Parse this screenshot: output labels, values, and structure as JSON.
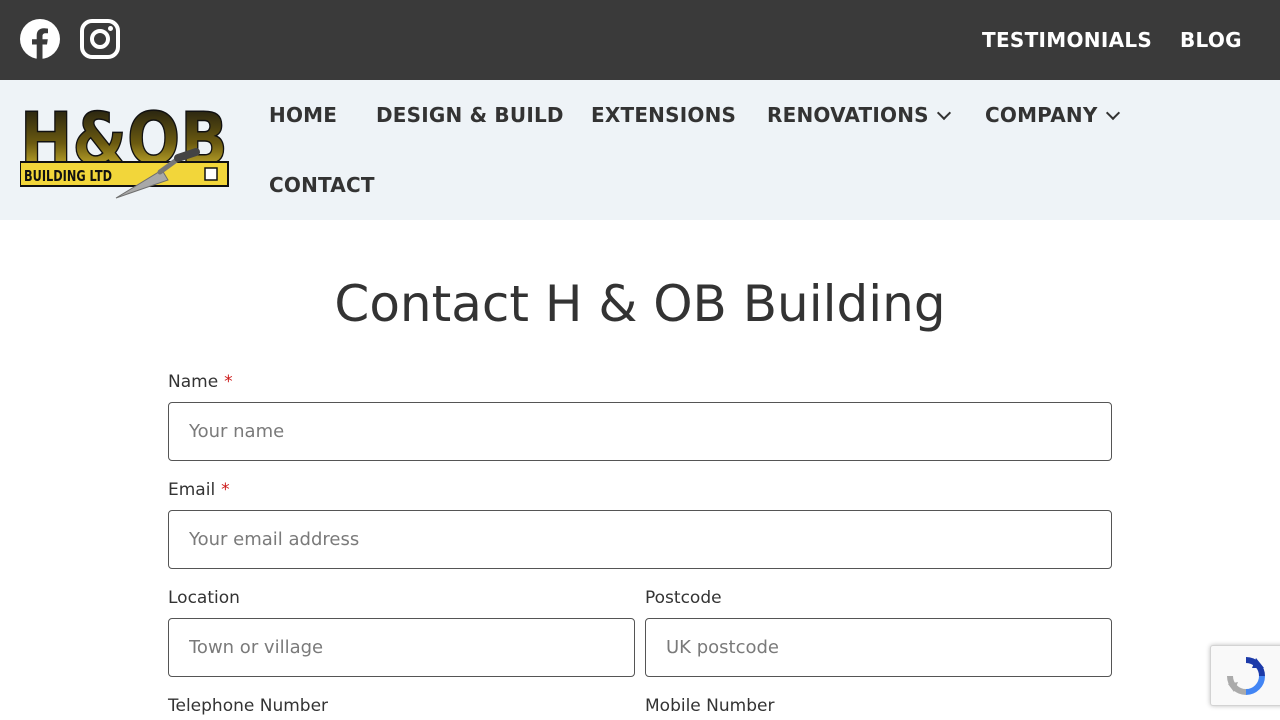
{
  "topbar": {
    "social": [
      {
        "name": "facebook-icon"
      },
      {
        "name": "instagram-icon"
      }
    ],
    "links": [
      "TESTIMONIALS",
      "BLOG"
    ]
  },
  "logo": {
    "text_main": "H&OB",
    "text_sub": "BUILDING LTD",
    "colors": {
      "yellow": "#f2d63a",
      "black": "#111111"
    }
  },
  "nav": {
    "items": [
      "HOME",
      "DESIGN & BUILD",
      "EXTENSIONS",
      "RENOVATIONS",
      "COMPANY",
      "CONTACT"
    ]
  },
  "page": {
    "title": "Contact H & OB Building"
  },
  "form": {
    "name": {
      "label": "Name",
      "required": "*",
      "placeholder": "Your name"
    },
    "email": {
      "label": "Email",
      "required": "*",
      "placeholder": "Your email address"
    },
    "location": {
      "label": "Location",
      "placeholder": "Town or village"
    },
    "postcode": {
      "label": "Postcode",
      "placeholder": "UK postcode"
    },
    "telephone": {
      "label": "Telephone Number"
    },
    "mobile": {
      "label": "Mobile Number"
    }
  },
  "colors": {
    "topbar_bg": "#3a3a3a",
    "header_bg": "#eef3f7",
    "required": "#cc1818"
  }
}
